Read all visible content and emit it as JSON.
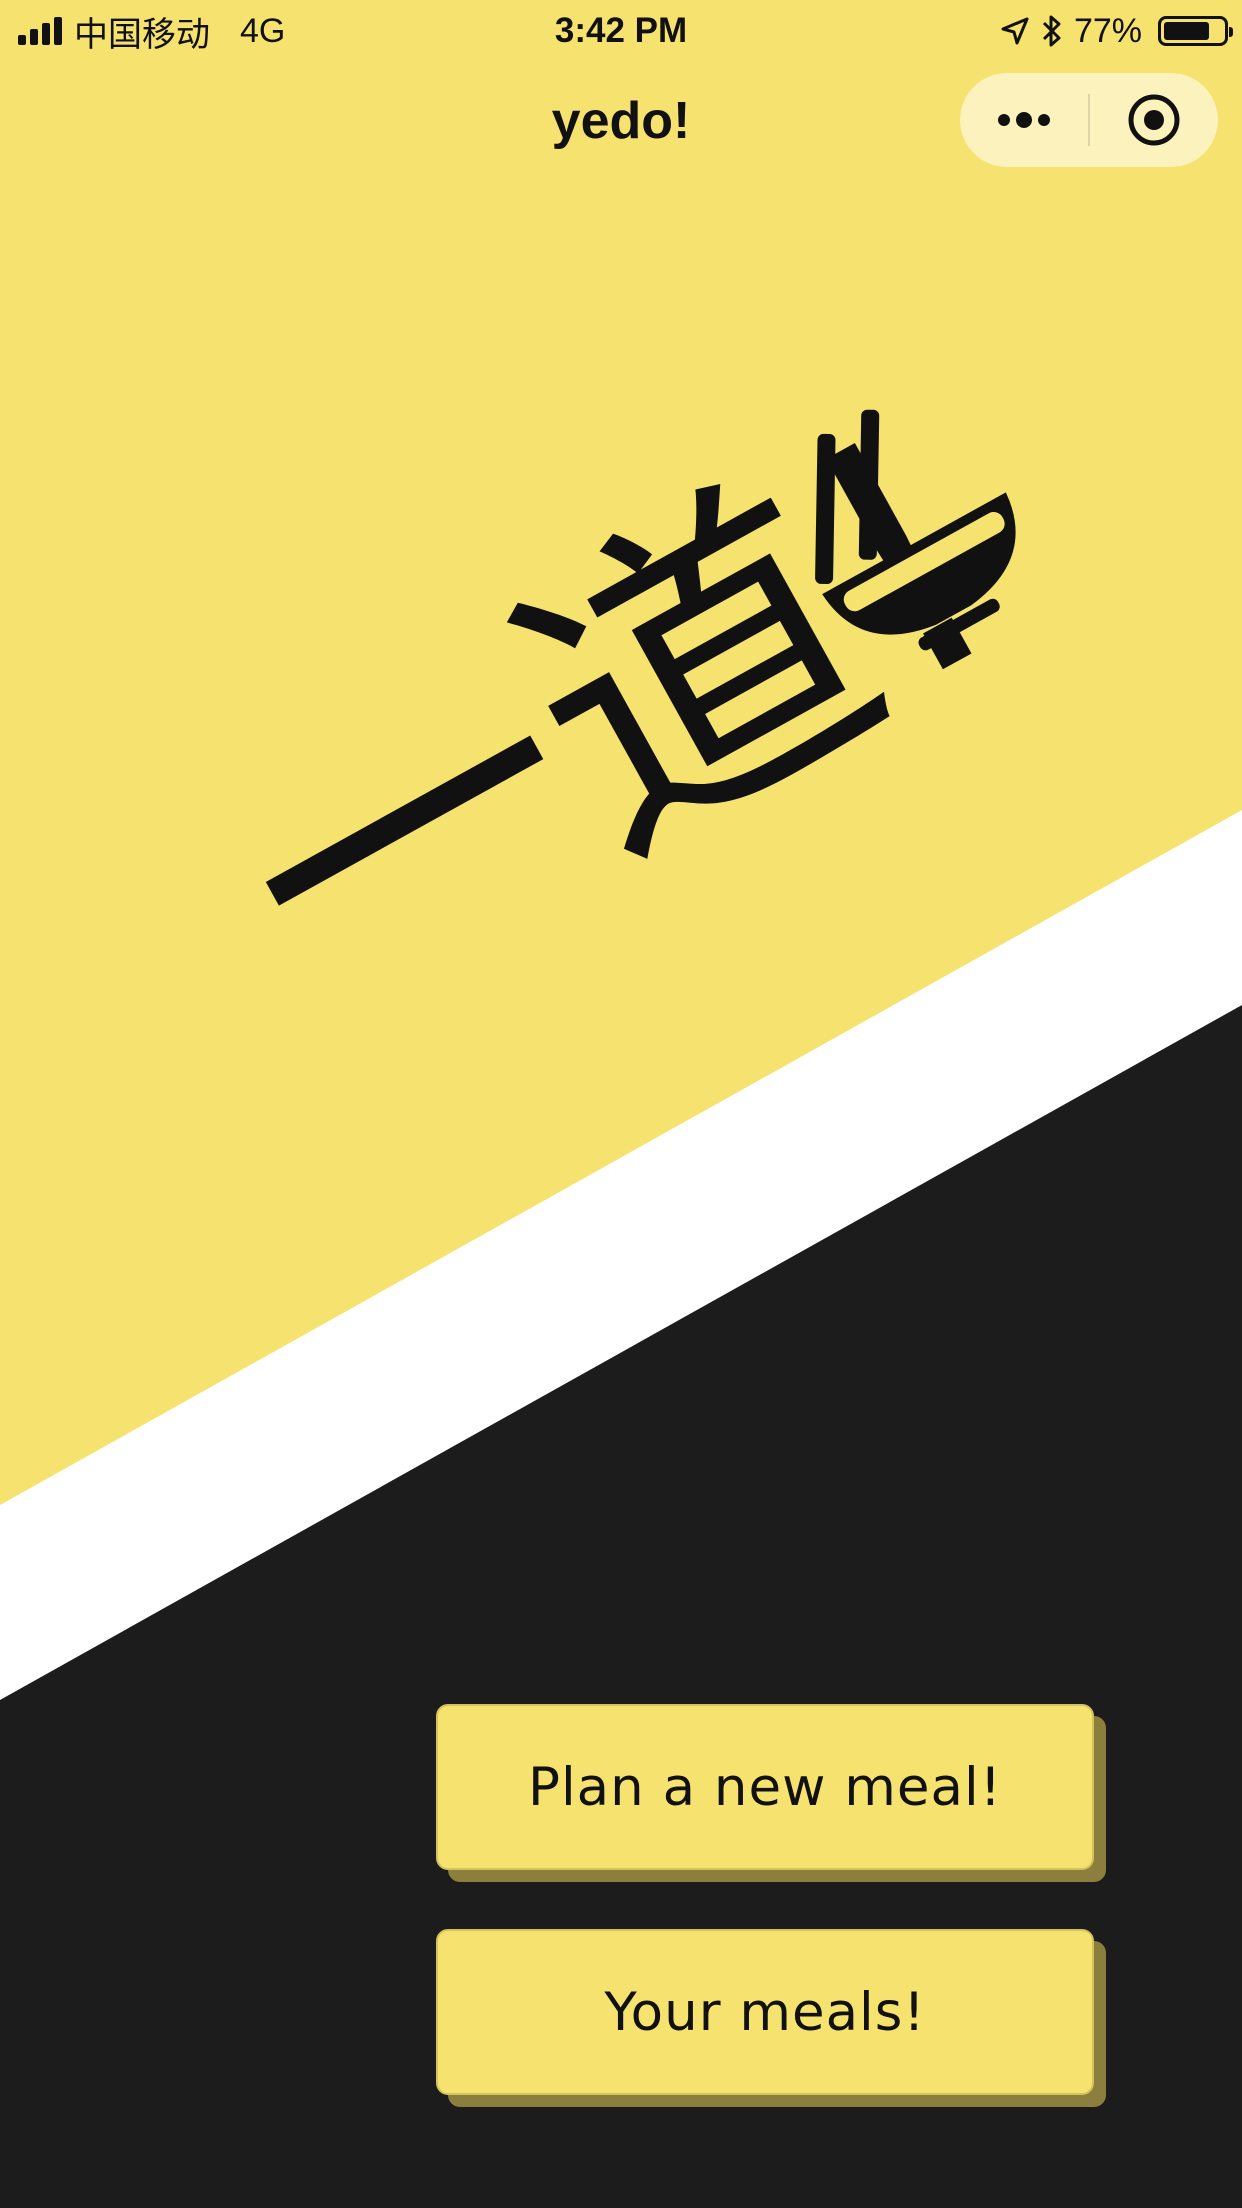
{
  "status_bar": {
    "carrier": "中国移动",
    "network": "4G",
    "time": "3:42 PM",
    "battery": "77%",
    "battery_level": 0.77,
    "icons": [
      "signal-icon",
      "location-arrow-icon",
      "bluetooth-icon",
      "battery-icon"
    ]
  },
  "nav": {
    "title": "yedo!",
    "more_icon": "more-dots-icon",
    "close_icon": "record-circle-icon"
  },
  "logo": {
    "text": "一道!",
    "icon": "bowl-chopsticks-icon"
  },
  "actions": {
    "plan_label": "Plan a new meal!",
    "meals_label": "Your meals!"
  },
  "colors": {
    "yellow": "#f6e26e",
    "dark": "#1c1c1c",
    "white": "#ffffff",
    "button_shadow": "#8c7e3c"
  }
}
